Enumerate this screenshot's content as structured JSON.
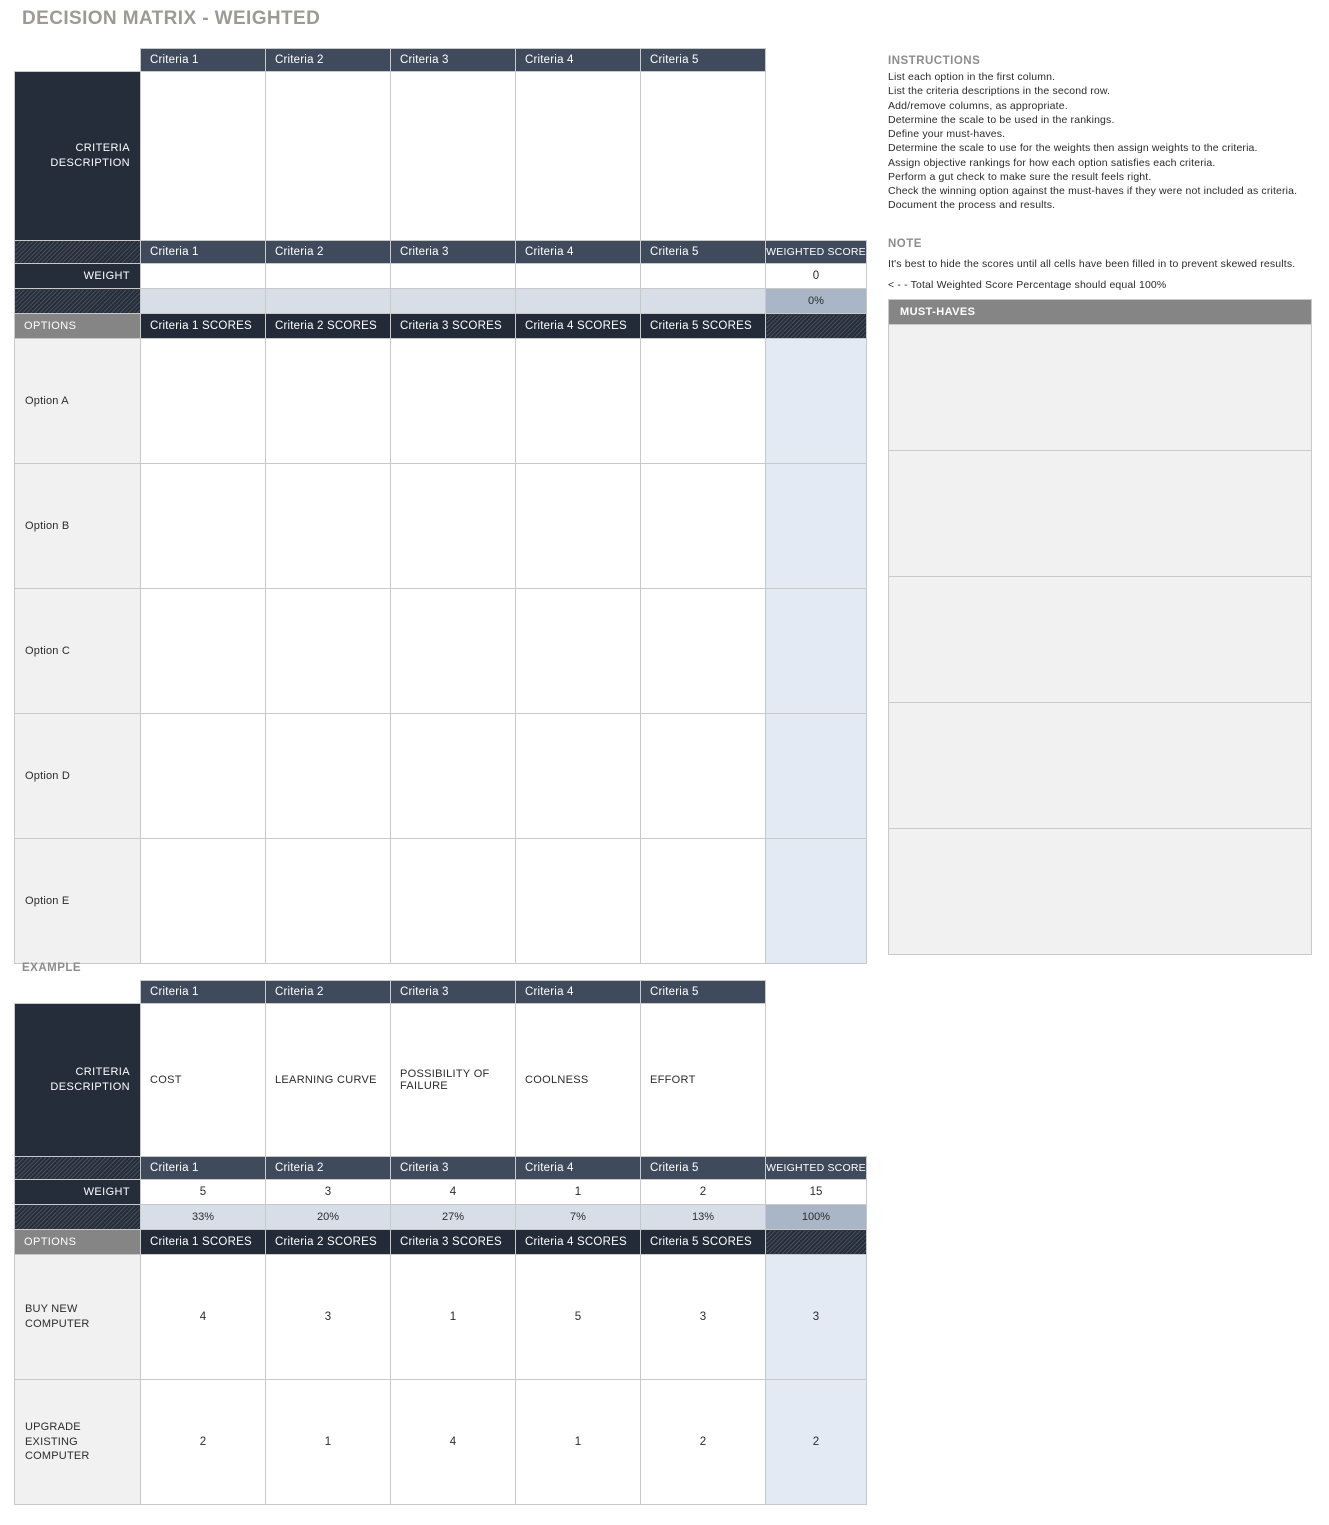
{
  "page": {
    "title": "DECISION MATRIX - WEIGHTED",
    "example_label": "EXAMPLE"
  },
  "labels": {
    "criteria_description": "CRITERIA\nDESCRIPTION",
    "criteria_description_line1": "CRITERIA",
    "criteria_description_line2": "DESCRIPTION",
    "weight": "WEIGHT",
    "options": "OPTIONS",
    "weighted_score": "WEIGHTED SCORE",
    "must_haves": "MUST-HAVES"
  },
  "criteria_headers": [
    "Criteria 1",
    "Criteria 2",
    "Criteria 3",
    "Criteria 4",
    "Criteria 5"
  ],
  "criteria_score_headers": [
    "Criteria 1 SCORES",
    "Criteria 2 SCORES",
    "Criteria 3 SCORES",
    "Criteria 4 SCORES",
    "Criteria 5 SCORES"
  ],
  "blank_matrix": {
    "criteria_descriptions": [
      "",
      "",
      "",
      "",
      ""
    ],
    "weights": [
      "",
      "",
      "",
      "",
      ""
    ],
    "weights_total": "0",
    "percentages": [
      "",
      "",
      "",
      "",
      ""
    ],
    "percentage_total": "0%",
    "options": [
      {
        "name": "Option A",
        "scores": [
          "",
          "",
          "",
          "",
          ""
        ],
        "weighted_score": ""
      },
      {
        "name": "Option B",
        "scores": [
          "",
          "",
          "",
          "",
          ""
        ],
        "weighted_score": ""
      },
      {
        "name": "Option C",
        "scores": [
          "",
          "",
          "",
          "",
          ""
        ],
        "weighted_score": ""
      },
      {
        "name": "Option D",
        "scores": [
          "",
          "",
          "",
          "",
          ""
        ],
        "weighted_score": ""
      },
      {
        "name": "Option E",
        "scores": [
          "",
          "",
          "",
          "",
          ""
        ],
        "weighted_score": ""
      }
    ],
    "must_haves": [
      "",
      "",
      "",
      "",
      ""
    ]
  },
  "example_matrix": {
    "criteria_descriptions": [
      "COST",
      "LEARNING CURVE",
      "POSSIBILITY OF FAILURE",
      "COOLNESS",
      "EFFORT"
    ],
    "weights": [
      "5",
      "3",
      "4",
      "1",
      "2"
    ],
    "weights_total": "15",
    "percentages": [
      "33%",
      "20%",
      "27%",
      "7%",
      "13%"
    ],
    "percentage_total": "100%",
    "options": [
      {
        "name": "BUY NEW COMPUTER",
        "scores": [
          "4",
          "3",
          "1",
          "5",
          "3"
        ],
        "weighted_score": "3"
      },
      {
        "name": "UPGRADE EXISTING COMPUTER",
        "scores": [
          "2",
          "1",
          "4",
          "1",
          "2"
        ],
        "weighted_score": "2"
      }
    ]
  },
  "instructions": {
    "heading": "INSTRUCTIONS",
    "lines": [
      "List each option in the first column.",
      "List the criteria descriptions in the second row.",
      "Add/remove columns, as appropriate.",
      "Determine the scale to be used in the rankings.",
      "Define your must-haves.",
      "Determine the scale to use for the weights then assign weights to the criteria.",
      "Assign objective rankings for how each option satisfies each criteria.",
      "Perform a gut check to make sure the result feels right.",
      "Check the winning option against the must-haves if they were not included as criteria.",
      "Document the process and results."
    ]
  },
  "note": {
    "heading": "NOTE",
    "line1": "It's best to hide the scores until all cells have been filled in to prevent skewed results.",
    "line2": "< - - Total Weighted Score Percentage should equal 100%"
  },
  "colors": {
    "title": "#9c9a93",
    "navy_dark": "#252d3a",
    "navy_slate": "#3f4a5c",
    "gray_header": "#858585",
    "pct_row": "#d7dee8",
    "pct_total": "#a9b6c7",
    "total_col": "#e3eaf3",
    "option_bg": "#f1f1f1",
    "border": "#c9c9c9"
  }
}
